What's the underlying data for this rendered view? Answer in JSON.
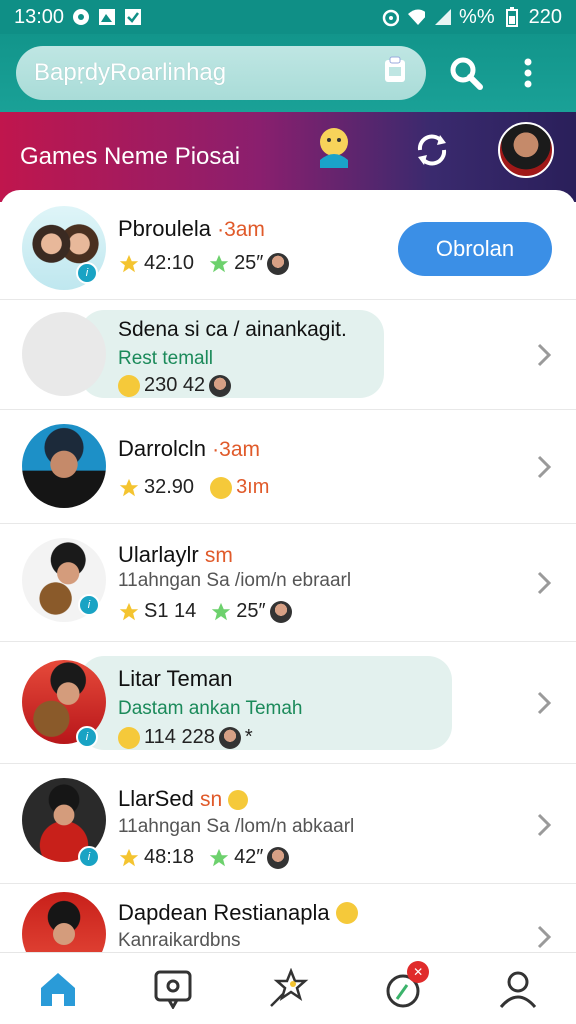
{
  "status_bar": {
    "time": "13:00",
    "battery_text": "%%",
    "battery_level": "220"
  },
  "search": {
    "placeholder": "BapṛdyRoarlinhag"
  },
  "banner": {
    "title": "Games Neme Piosai"
  },
  "rows": [
    {
      "name": "Pbroulela",
      "time": "·3am",
      "stat1": "42:10",
      "stat2": "25″",
      "button": "Obrolan"
    },
    {
      "name": "Sdena si ca / ainankagit.",
      "sub": "Rest temall",
      "stat1": "230 42"
    },
    {
      "name": "Darrolcln",
      "time": "·3am",
      "stat1": "32.90",
      "stat2": "3ım"
    },
    {
      "name": "Ularlaylr",
      "time": "sm",
      "sub": "11ahngan Sa /iom/n ebraarl",
      "stat1": "S1 14",
      "stat2": "25″"
    },
    {
      "name": "Litar Teman",
      "sub": "Dastam ankan Temah",
      "stat1": "114 228",
      "stat2": "*"
    },
    {
      "name": "LlarSed",
      "time": "sn",
      "sub": "11ahngan Sa /lom/n abkaarl",
      "stat1": "48:18",
      "stat2": "42″"
    },
    {
      "name": "Dapdean Restianapla",
      "sub": "Kanraikardbns"
    }
  ]
}
